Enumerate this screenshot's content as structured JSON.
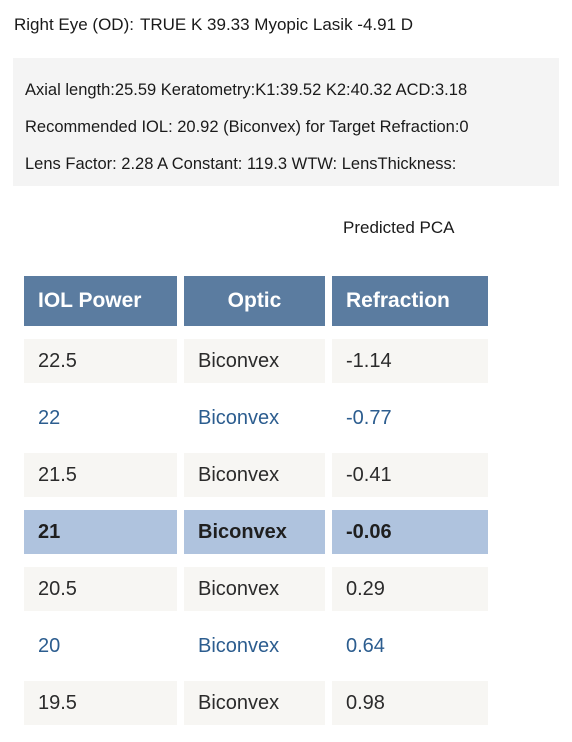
{
  "eye_header": {
    "label": "Right Eye (OD):",
    "detail": "TRUE K 39.33 Myopic Lasik -4.91 D"
  },
  "summary": {
    "line1": "Axial length:25.59  Keratometry:K1:39.52 K2:40.32  ACD:3.18",
    "line2": "Recommended IOL: 20.92 (Biconvex) for Target Refraction:0",
    "line3": "Lens Factor: 2.28 A Constant: 119.3 WTW: LensThickness:"
  },
  "predicted_pca_caption": "Predicted PCA",
  "table": {
    "columns": [
      "IOL Power",
      "Optic",
      "Refraction"
    ],
    "rows": [
      {
        "power": "22.5",
        "optic": "Biconvex",
        "refraction": "-1.14",
        "style": "shaded"
      },
      {
        "power": "22",
        "optic": "Biconvex",
        "refraction": "-0.77",
        "style": "plain"
      },
      {
        "power": "21.5",
        "optic": "Biconvex",
        "refraction": "-0.41",
        "style": "shaded"
      },
      {
        "power": "21",
        "optic": "Biconvex",
        "refraction": "-0.06",
        "style": "selected"
      },
      {
        "power": "20.5",
        "optic": "Biconvex",
        "refraction": "0.29",
        "style": "shaded"
      },
      {
        "power": "20",
        "optic": "Biconvex",
        "refraction": "0.64",
        "style": "plain"
      },
      {
        "power": "19.5",
        "optic": "Biconvex",
        "refraction": "0.98",
        "style": "shaded"
      }
    ]
  },
  "colors": {
    "header_bg": "#5b7ca0",
    "header_text": "#ffffff",
    "row_shaded_bg": "#f7f6f3",
    "row_plain_text": "#2c5d8f",
    "row_selected_bg": "#afc3de",
    "summary_bg": "#f4f4f4"
  }
}
